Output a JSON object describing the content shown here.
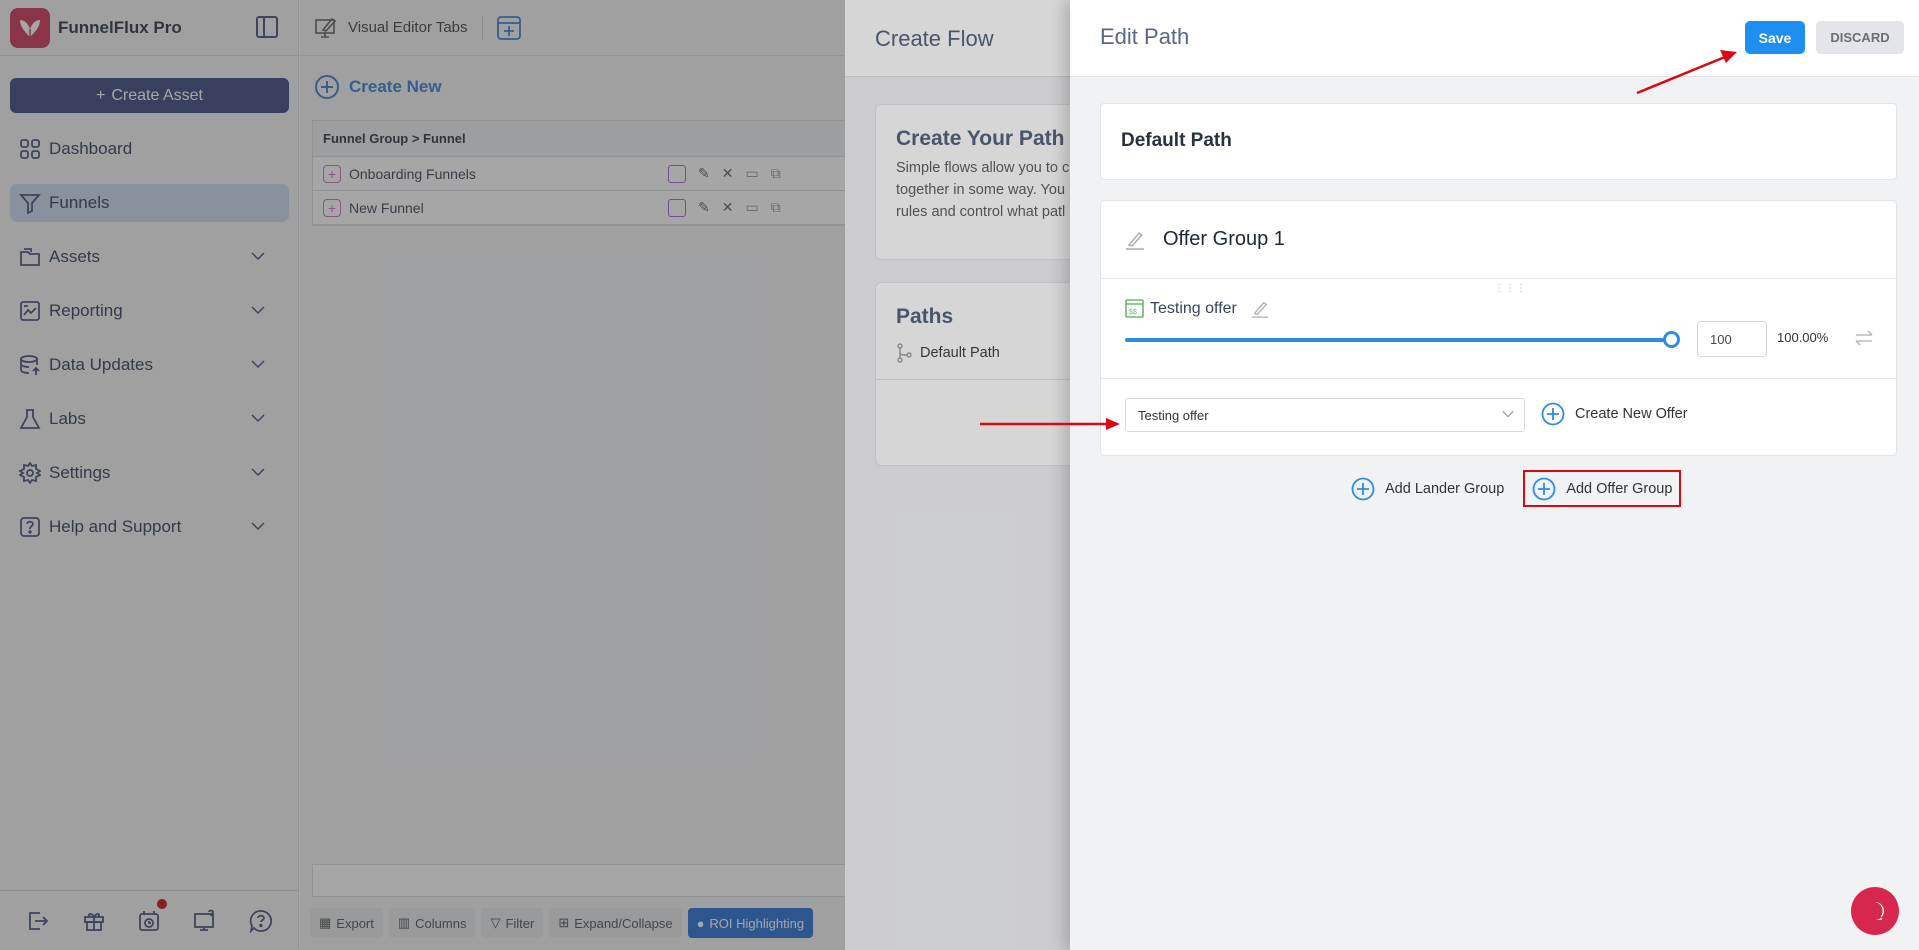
{
  "app": {
    "name": "FunnelFlux Pro"
  },
  "sidebar": {
    "create_asset": "Create Asset",
    "items": [
      {
        "label": "Dashboard",
        "icon": "grid-icon",
        "active": false,
        "expandable": false
      },
      {
        "label": "Funnels",
        "icon": "funnel-icon",
        "active": true,
        "expandable": false
      },
      {
        "label": "Assets",
        "icon": "folder-icon",
        "active": false,
        "expandable": true
      },
      {
        "label": "Reporting",
        "icon": "report-chart-icon",
        "active": false,
        "expandable": true
      },
      {
        "label": "Data Updates",
        "icon": "database-upload-icon",
        "active": false,
        "expandable": true
      },
      {
        "label": "Labs",
        "icon": "flask-icon",
        "active": false,
        "expandable": true
      },
      {
        "label": "Settings",
        "icon": "gear-icon",
        "active": false,
        "expandable": true
      },
      {
        "label": "Help and Support",
        "icon": "question-icon",
        "active": false,
        "expandable": true
      }
    ],
    "footer_icons": [
      "logout-icon",
      "gift-icon",
      "calendar-clock-icon",
      "monitor-help-icon",
      "chat-help-icon"
    ],
    "notification_dot_color": "#c40000"
  },
  "topbar": {
    "visual_editor_tabs": "Visual Editor Tabs"
  },
  "main": {
    "create_new": "Create New",
    "grid": {
      "header": "Funnel Group > Funnel",
      "rows": [
        {
          "name": "Onboarding Funnels"
        },
        {
          "name": "New Funnel"
        }
      ]
    },
    "toolbar": [
      {
        "label": "Export",
        "icon": "excel-icon"
      },
      {
        "label": "Columns",
        "icon": "columns-icon"
      },
      {
        "label": "Filter",
        "icon": "filter-icon"
      },
      {
        "label": "Expand/Collapse",
        "icon": "tree-icon"
      },
      {
        "label": "ROI Highlighting",
        "icon": "drop-icon",
        "active": true
      }
    ]
  },
  "create_flow": {
    "title": "Create Flow",
    "intro_title": "Create Your Path U",
    "intro_lines": [
      "Simple flows allow you to c",
      "together in some way. You",
      "rules and control what patl"
    ],
    "paths_title": "Paths",
    "paths": [
      "Default Path"
    ]
  },
  "edit_path": {
    "title": "Edit Path",
    "save": "Save",
    "discard": "DISCARD",
    "path_name": "Default Path",
    "offer_group": {
      "name": "Offer Group 1",
      "offers": [
        {
          "name": "Testing offer",
          "weight": "100",
          "percent": "100.00%",
          "slider_fraction": 1.0
        }
      ],
      "select_value": "Testing offer",
      "create_new_offer": "Create New Offer"
    },
    "add_lander_group": "Add Lander Group",
    "add_offer_group": "Add Offer Group"
  },
  "colors": {
    "accent_blue": "#1e8ef0",
    "brand_red": "#c8264d",
    "annotation_red": "#d90a12",
    "sidebar_button": "#2d3a78"
  }
}
